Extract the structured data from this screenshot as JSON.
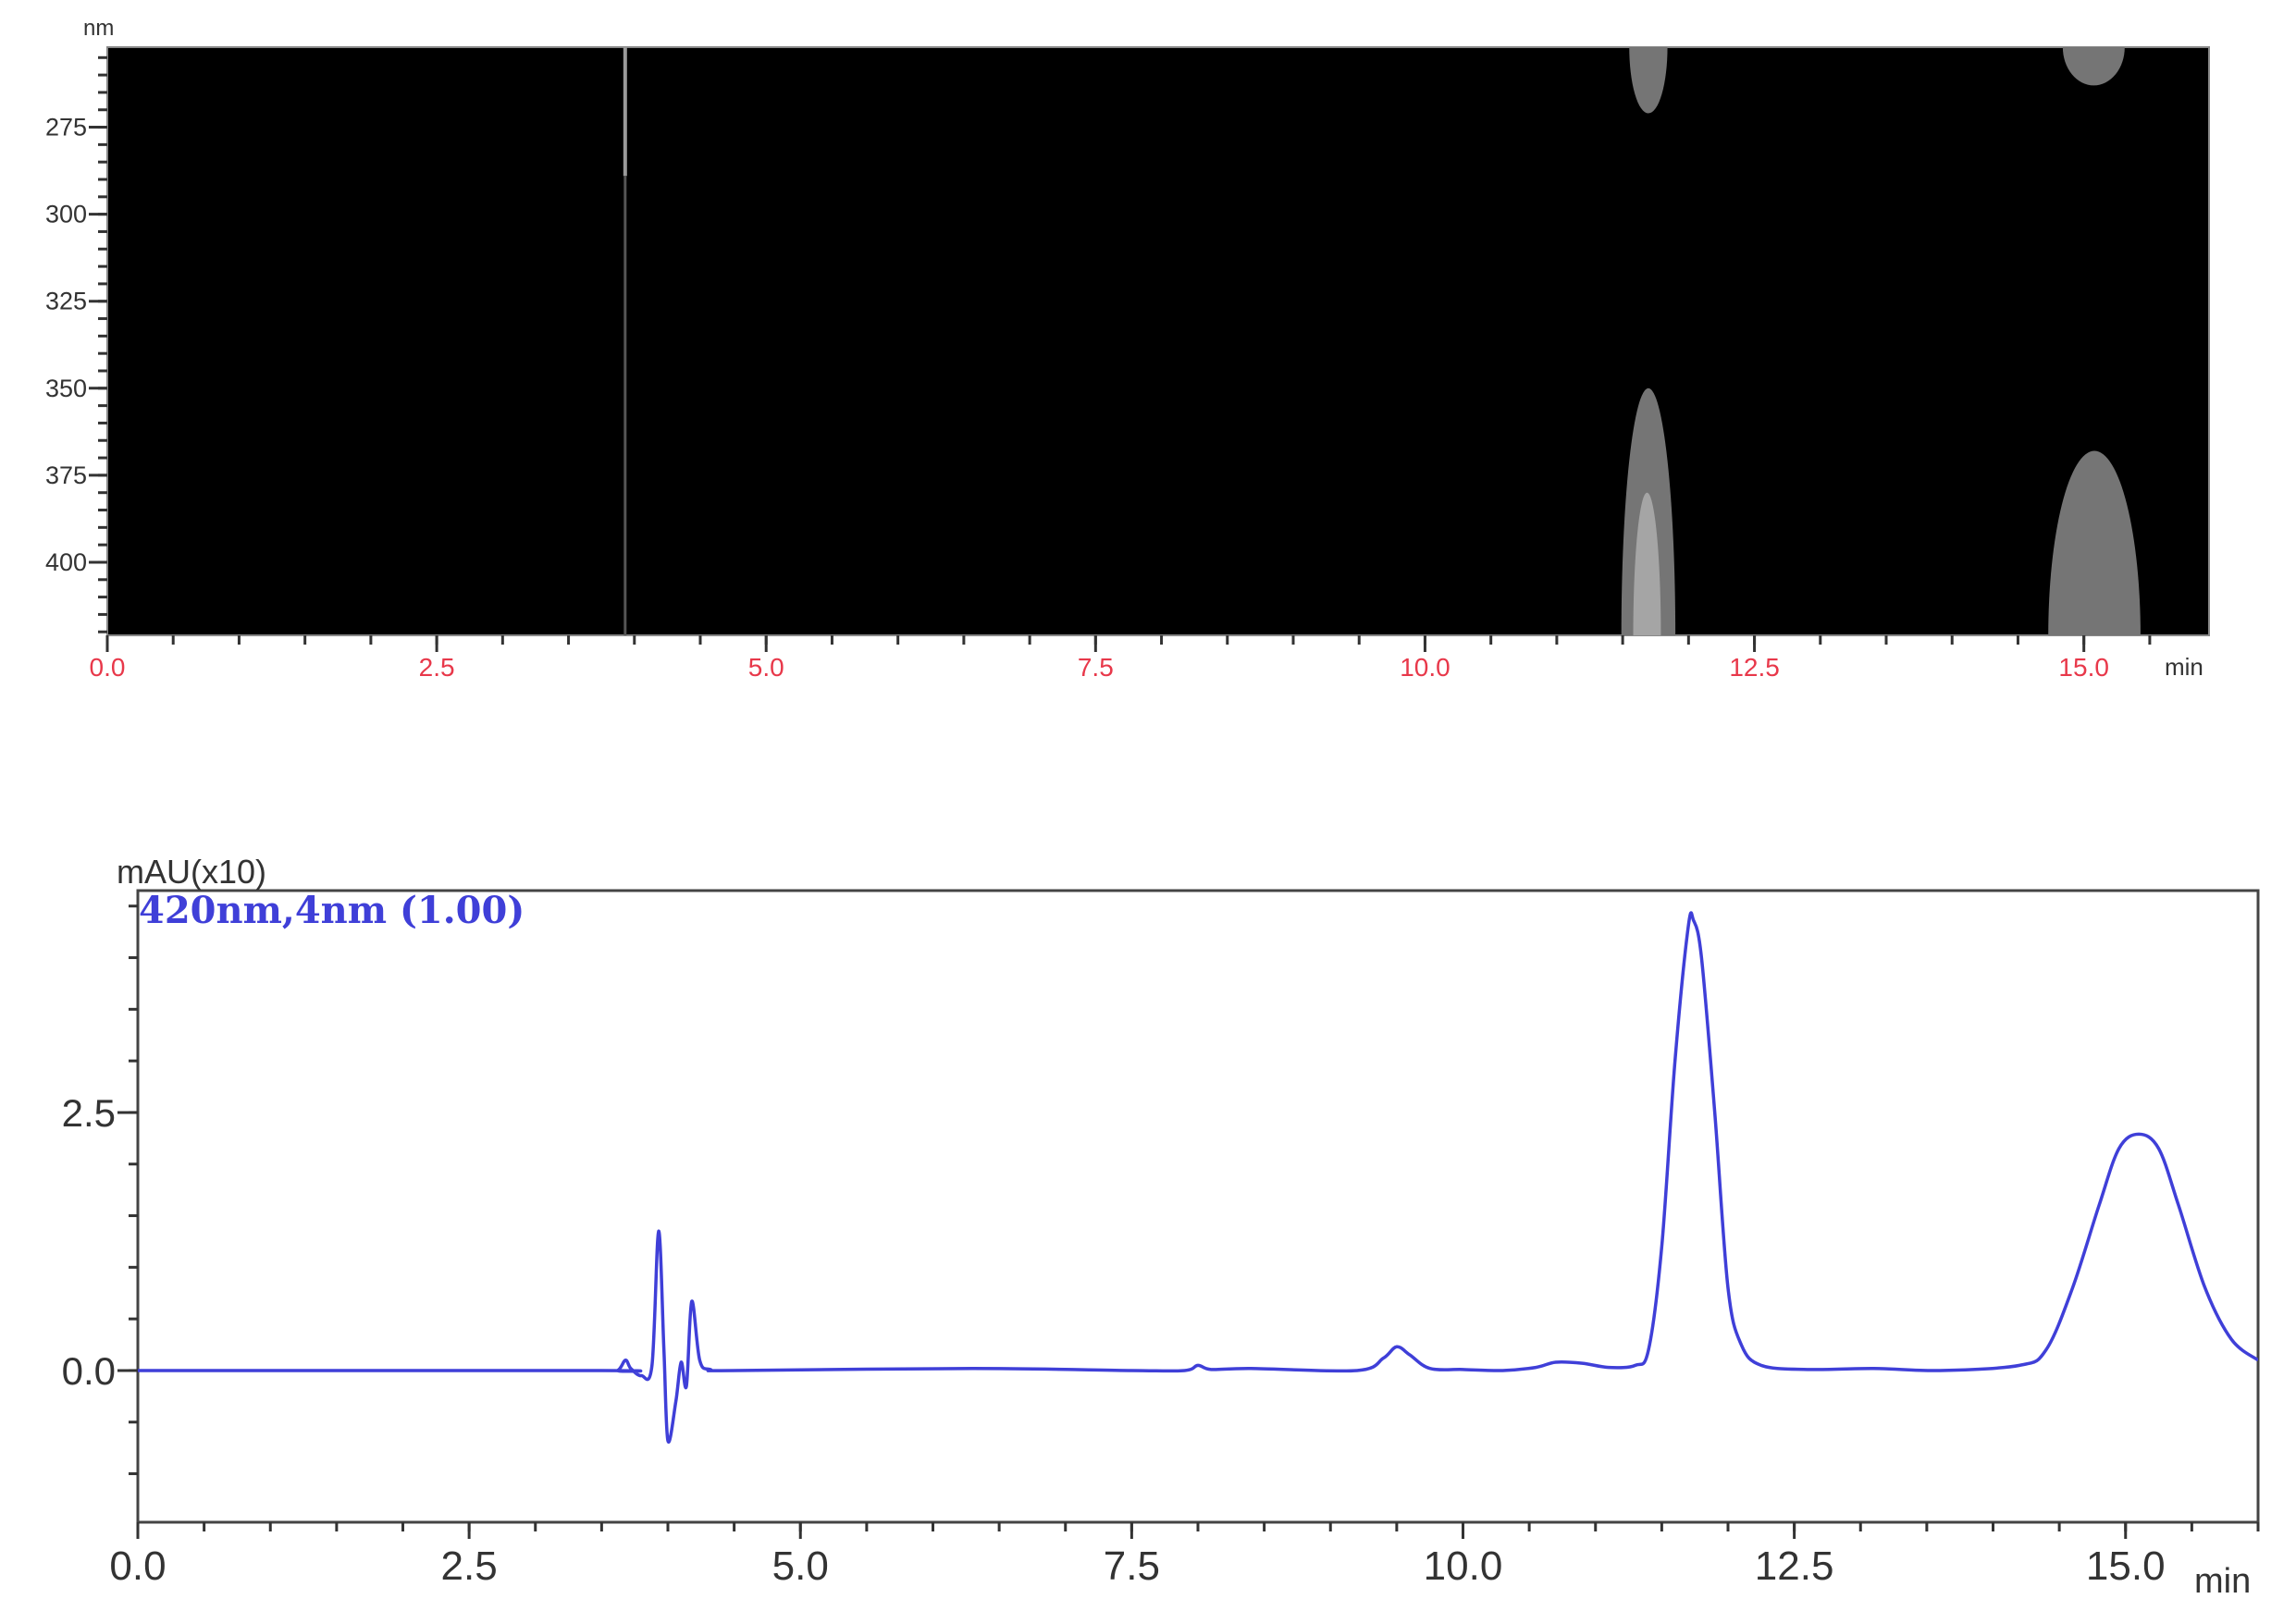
{
  "chart_data": [
    {
      "type": "heatmap",
      "title": "",
      "xlabel": "min",
      "ylabel": "nm",
      "xlim": [
        0,
        15.95
      ],
      "ylim": [
        252,
        421
      ],
      "y_inverted": true,
      "x_ticks": [
        0,
        2.5,
        5,
        7.5,
        10,
        12.5,
        15
      ],
      "x_tick_labels": [
        "0.0",
        "2.5",
        "5.0",
        "7.5",
        "10.0",
        "12.5",
        "15.0"
      ],
      "x_minor_step": 0.5,
      "y_ticks": [
        275,
        300,
        325,
        350,
        375,
        400
      ],
      "y_tick_labels": [
        "275",
        "300",
        "325",
        "350",
        "375",
        "400"
      ],
      "y_minor_step": 5,
      "tick_label_color": "#e8384a",
      "background_color": "#000000",
      "features": [
        {
          "name": "injection-line",
          "kind": "line",
          "time": 3.93,
          "nm_range": [
            252,
            421
          ],
          "bright_until_nm": 289
        },
        {
          "name": "band-11.7-top",
          "kind": "blob-top",
          "time_range": [
            11.55,
            11.84
          ],
          "nm_edge": 271,
          "intensity": 0.38
        },
        {
          "name": "band-11.7-bottom",
          "kind": "blob-bottom",
          "time_range": [
            11.49,
            11.9
          ],
          "nm_edge": 350,
          "intensity": 0.38
        },
        {
          "name": "band-11.7-core",
          "kind": "blob-bottom",
          "time_range": [
            11.58,
            11.79
          ],
          "nm_edge": 380,
          "intensity": 0.7
        },
        {
          "name": "band-15.1-top",
          "kind": "blob-top",
          "time_range": [
            14.84,
            15.31
          ],
          "nm_edge": 263,
          "intensity": 0.38
        },
        {
          "name": "band-15.1-bottom",
          "kind": "blob-bottom",
          "time_range": [
            14.73,
            15.43
          ],
          "nm_edge": 368,
          "intensity": 0.38
        }
      ]
    },
    {
      "type": "line",
      "title": "",
      "xlabel": "min",
      "ylabel": "mAU(x10)",
      "xlim": [
        0,
        16.0
      ],
      "ylim": [
        -1.47,
        4.65
      ],
      "x_ticks": [
        0,
        2.5,
        5,
        7.5,
        10,
        12.5,
        15
      ],
      "x_tick_labels": [
        "0.0",
        "2.5",
        "5.0",
        "7.5",
        "10.0",
        "12.5",
        "15.0"
      ],
      "x_minor_step": 0.5,
      "y_ticks": [
        0,
        2.5
      ],
      "y_tick_labels": [
        "0.0",
        "2.5"
      ],
      "y_minor_step": 0.5,
      "series": [
        {
          "name": "420nm,4nm (1.00)",
          "color": "#3f3fd8",
          "x": [
            0,
            3.5,
            3.62,
            3.68,
            3.72,
            3.8,
            3.88,
            3.93,
            3.97,
            4.0,
            4.06,
            4.1,
            4.14,
            4.18,
            4.24,
            4.32,
            4.5,
            6.3,
            7.5,
            7.9,
            8.0,
            8.1,
            8.4,
            9.2,
            9.4,
            9.5,
            9.6,
            9.75,
            10.0,
            10.3,
            10.55,
            10.7,
            10.9,
            11.1,
            11.3,
            11.4,
            11.5,
            11.6,
            11.7,
            11.74,
            11.8,
            11.9,
            12.0,
            12.1,
            12.25,
            12.6,
            13.1,
            13.6,
            14.2,
            14.4,
            14.6,
            14.8,
            14.95,
            15.1,
            15.25,
            15.4,
            15.6,
            15.8,
            16.0
          ],
          "y": [
            0,
            0,
            0,
            0.1,
            0.02,
            -0.05,
            0.05,
            1.35,
            0.2,
            -0.68,
            -0.3,
            0.08,
            -0.15,
            0.67,
            0.1,
            0.01,
            0,
            0.02,
            0,
            0,
            0.05,
            0.01,
            0.02,
            0,
            0.12,
            0.23,
            0.15,
            0.02,
            0.01,
            0,
            0.03,
            0.08,
            0.07,
            0.03,
            0.05,
            0.2,
            1.2,
            3.0,
            4.3,
            4.36,
            4.0,
            2.5,
            0.8,
            0.25,
            0.05,
            0.01,
            0.02,
            0,
            0.05,
            0.2,
            0.8,
            1.6,
            2.15,
            2.29,
            2.15,
            1.6,
            0.8,
            0.3,
            0.1
          ]
        }
      ]
    }
  ]
}
